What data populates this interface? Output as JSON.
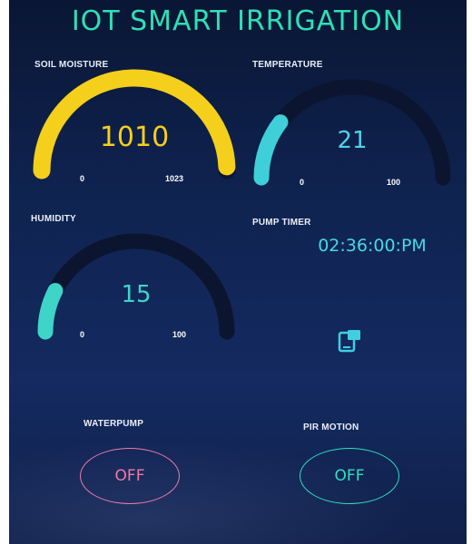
{
  "app": {
    "title": "IOT SMART IRRIGATION"
  },
  "soil_moisture": {
    "label": "SOIL MOISTURE",
    "value": "1010",
    "min": "0",
    "max": "1023",
    "fraction": 0.987,
    "color": "#f4cf1c"
  },
  "temperature": {
    "label": "TEMPERATURE",
    "value": "21",
    "min": "0",
    "max": "100",
    "fraction": 0.21,
    "color": "#3fcfd8"
  },
  "humidity": {
    "label": "HUMIDITY",
    "value": "15",
    "min": "0",
    "max": "100",
    "fraction": 0.15,
    "color": "#3fd4c8"
  },
  "pump_timer": {
    "label": "PUMP TIMER",
    "value": "02:36:00:PM",
    "icon": "device-icon"
  },
  "waterpump": {
    "label": "WATERPUMP",
    "state": "OFF",
    "color": "#f07aa8"
  },
  "pir_motion": {
    "label": "PIR MOTION",
    "state": "OFF",
    "color": "#2ee0c0"
  }
}
